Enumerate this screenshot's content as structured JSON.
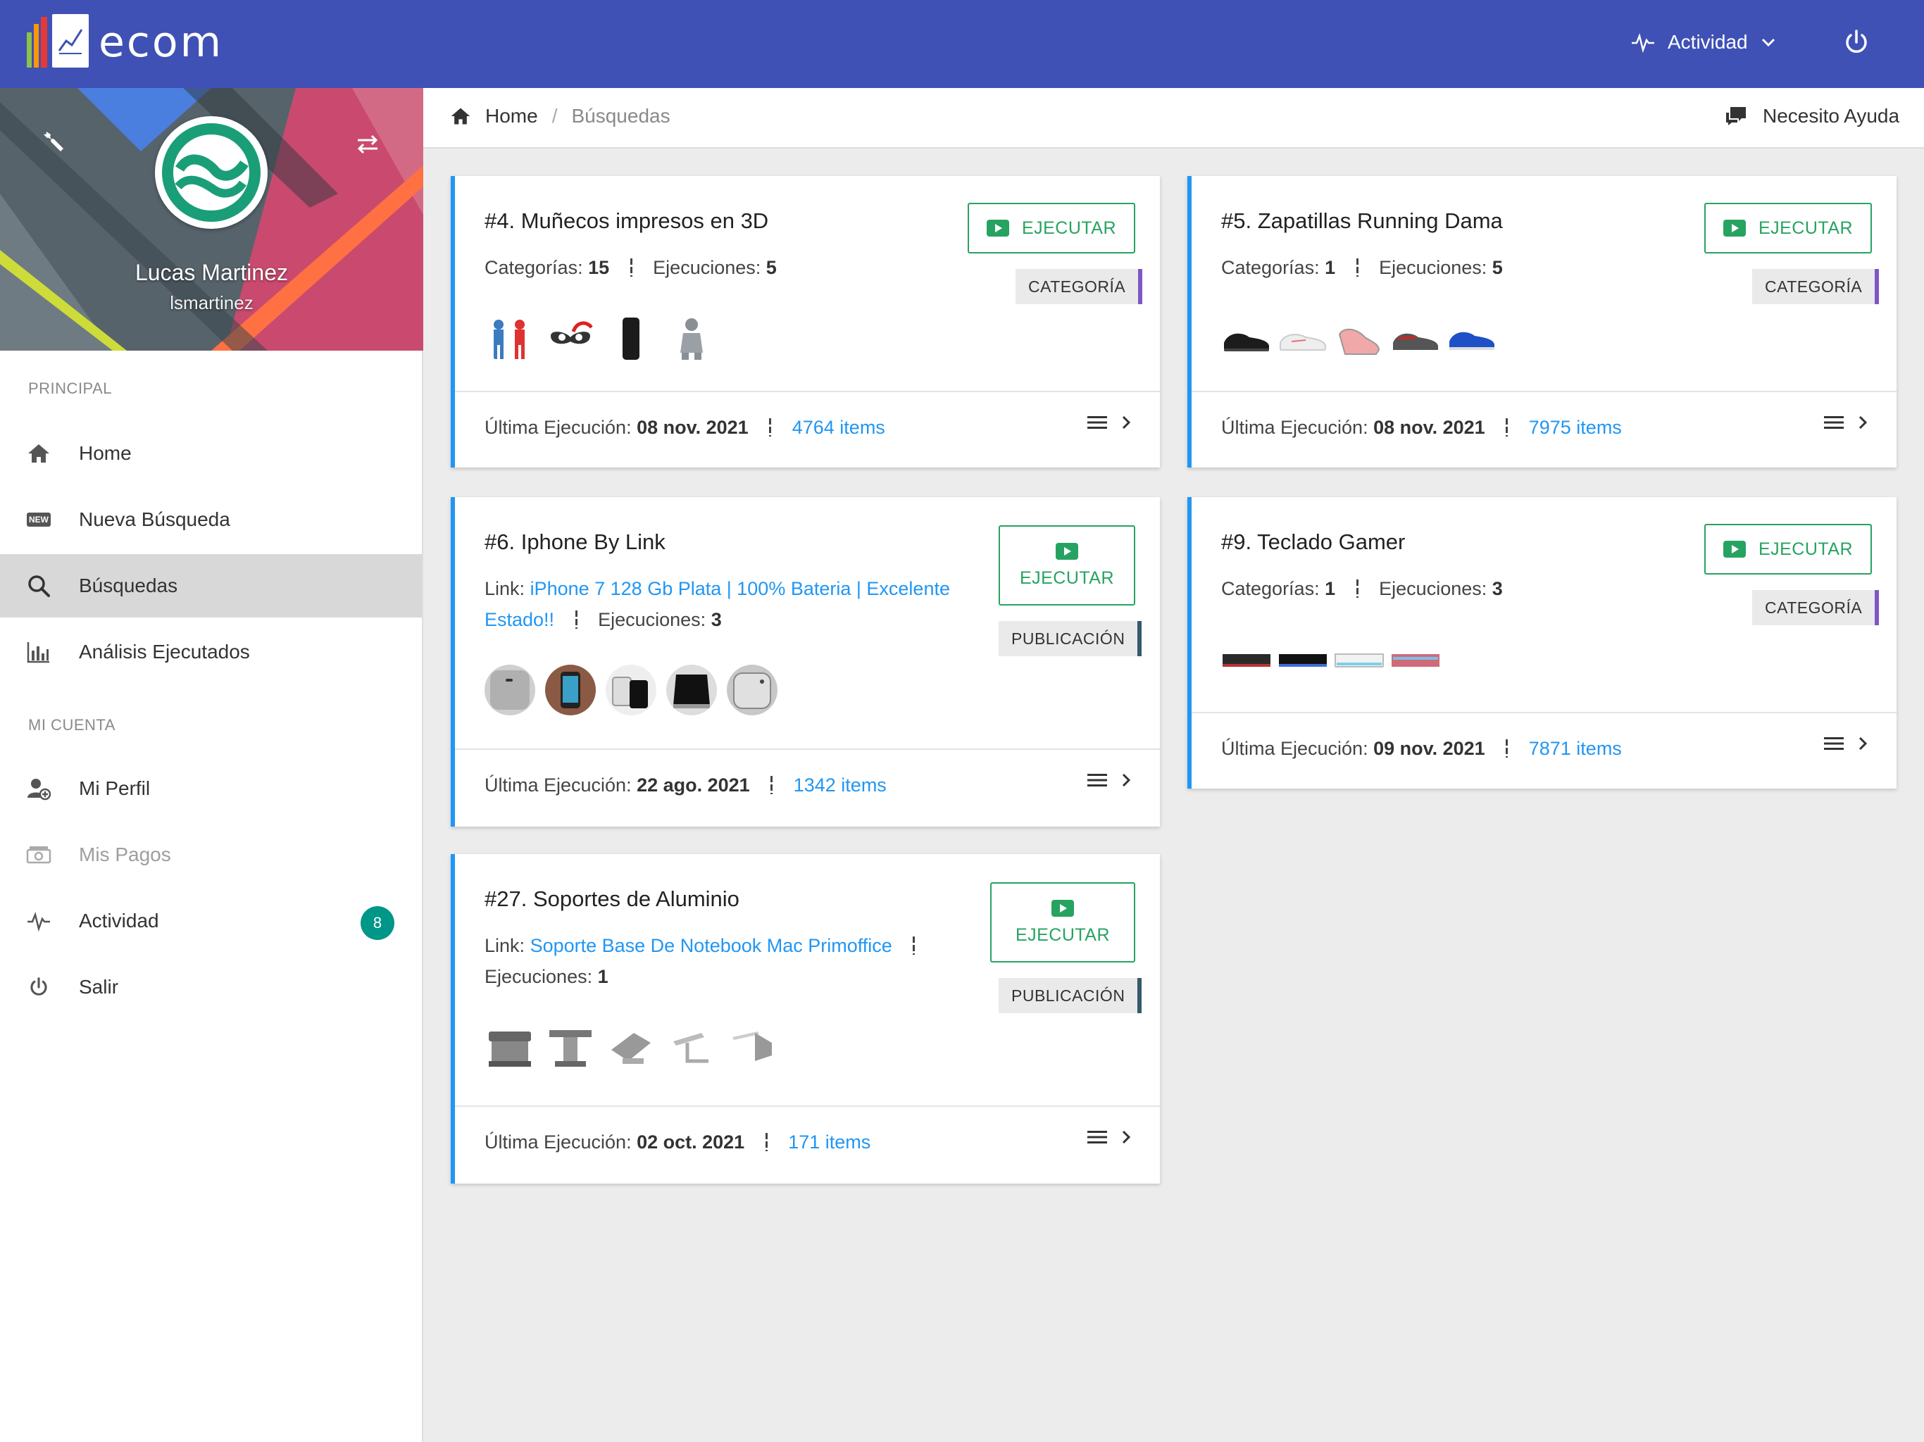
{
  "app": {
    "name": "ecom"
  },
  "header": {
    "activity_label": "Actividad"
  },
  "profile": {
    "name": "Lucas Martinez",
    "username": "lsmartinez"
  },
  "sidebar": {
    "sections": [
      {
        "title": "PRINCIPAL"
      },
      {
        "title": "MI CUENTA"
      }
    ],
    "items": [
      {
        "label": "Home"
      },
      {
        "label": "Nueva Búsqueda"
      },
      {
        "label": "Búsquedas"
      },
      {
        "label": "Análisis Ejecutados"
      },
      {
        "label": "Mi Perfil"
      },
      {
        "label": "Mis Pagos"
      },
      {
        "label": "Actividad",
        "badge": "8"
      },
      {
        "label": "Salir"
      }
    ],
    "new_icon_text": "NEW"
  },
  "breadcrumb": {
    "home": "Home",
    "separator": "/",
    "current": "Búsquedas",
    "help": "Necesito Ayuda"
  },
  "labels": {
    "execute": "EJECUTAR",
    "last_run": "Última Ejecución:",
    "categories": "Categorías:",
    "executions": "Ejecuciones:",
    "link": "Link:"
  },
  "cards": [
    {
      "title": "#4. Muñecos impresos en 3D",
      "categories": "15",
      "executions": "5",
      "tag": "CATEGORÍA",
      "last_run": "08 nov. 2021",
      "items": "4764 items"
    },
    {
      "title": "#5. Zapatillas Running Dama",
      "categories": "1",
      "executions": "5",
      "tag": "CATEGORÍA",
      "last_run": "08 nov. 2021",
      "items": "7975 items"
    },
    {
      "title": "#6. Iphone By Link",
      "link_line1": "iPhone 7 128 Gb Plata | 100% Bateria | Excelente",
      "link_line2": "Estado!!",
      "executions": "3",
      "tag": "PUBLICACIÓN",
      "last_run": "22 ago. 2021",
      "items": "1342 items"
    },
    {
      "title": "#9. Teclado Gamer",
      "categories": "1",
      "executions": "3",
      "tag": "CATEGORÍA",
      "last_run": "09 nov. 2021",
      "items": "7871 items"
    },
    {
      "title": "#27. Soportes de Aluminio",
      "link_line1": "Soporte Base De Notebook Mac Primoffice",
      "executions": "1",
      "tag": "PUBLICACIÓN",
      "last_run": "02 oct. 2021",
      "items": "171 items"
    }
  ],
  "colors": {
    "topbar": "#3f51b5",
    "accent_border": "#2196f3",
    "execute_green": "#27a361",
    "badge_teal": "#009688",
    "tag_category": "#7e57c2",
    "tag_publication": "#37596b"
  }
}
